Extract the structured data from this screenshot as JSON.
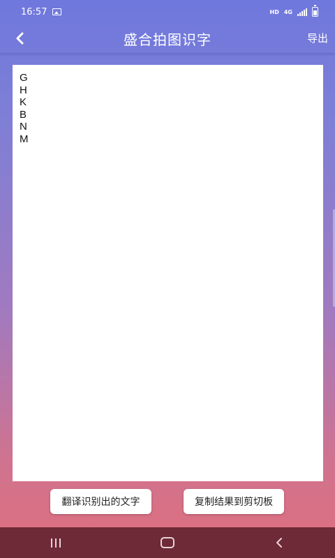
{
  "status_bar": {
    "time": "16:57",
    "hd": "HD",
    "network": "4G"
  },
  "app_bar": {
    "title": "盛合拍图识字",
    "export_label": "导出"
  },
  "result": {
    "text": "G\nH\nK\nB\nN\nM"
  },
  "actions": {
    "translate_label": "翻译识别出的文字",
    "copy_label": "复制结果到剪切板"
  },
  "icons": {
    "back": "back-arrow-icon",
    "gallery": "image-icon",
    "signal": "signal-icon",
    "battery": "battery-icon",
    "nav_recent": "recent-apps-icon",
    "nav_home": "home-icon",
    "nav_back": "back-icon"
  }
}
